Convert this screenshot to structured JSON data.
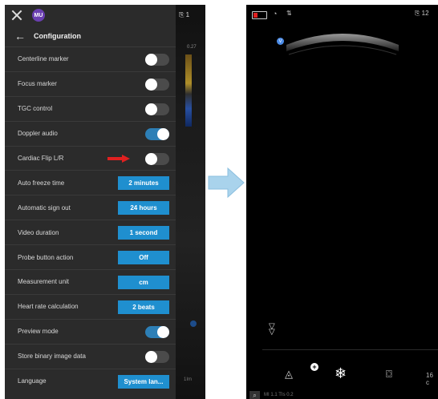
{
  "left_screen": {
    "avatar_initials": "MU",
    "title": "Configuration",
    "top_badge": "1",
    "scale_label": "0.27",
    "bottom_strip_text": "1Im",
    "settings": [
      {
        "label": "Centerline marker",
        "kind": "toggle",
        "on": false
      },
      {
        "label": "Focus marker",
        "kind": "toggle",
        "on": false
      },
      {
        "label": "TGC control",
        "kind": "toggle",
        "on": false
      },
      {
        "label": "Doppler audio",
        "kind": "toggle",
        "on": true
      },
      {
        "label": "Cardiac Flip L/R",
        "kind": "toggle",
        "on": false,
        "highlight_arrow": true
      },
      {
        "label": "Auto freeze time",
        "kind": "select",
        "value": "2 minutes"
      },
      {
        "label": "Automatic sign out",
        "kind": "select",
        "value": "24 hours"
      },
      {
        "label": "Video duration",
        "kind": "select",
        "value": "1 second"
      },
      {
        "label": "Probe button action",
        "kind": "select",
        "value": "Off"
      },
      {
        "label": "Measurement unit",
        "kind": "select",
        "value": "cm"
      },
      {
        "label": "Heart rate calculation",
        "kind": "select",
        "value": "2 beats"
      },
      {
        "label": "Preview mode",
        "kind": "toggle",
        "on": true
      },
      {
        "label": "Store binary image data",
        "kind": "toggle",
        "on": false
      },
      {
        "label": "Language",
        "kind": "select",
        "value": "System lan..."
      }
    ]
  },
  "right_screen": {
    "top_badge": "12",
    "probe_marker": "V",
    "depth_label": "16 c",
    "footer_text": "MI 1.1  TIs 0.2"
  },
  "colors": {
    "panel_bg": "#2b2b2b",
    "toggle_on": "#2d7fb6",
    "select_bg": "#1f8fcf",
    "highlight_arrow": "#e02020",
    "transition_arrow": "#a9d3ec"
  }
}
